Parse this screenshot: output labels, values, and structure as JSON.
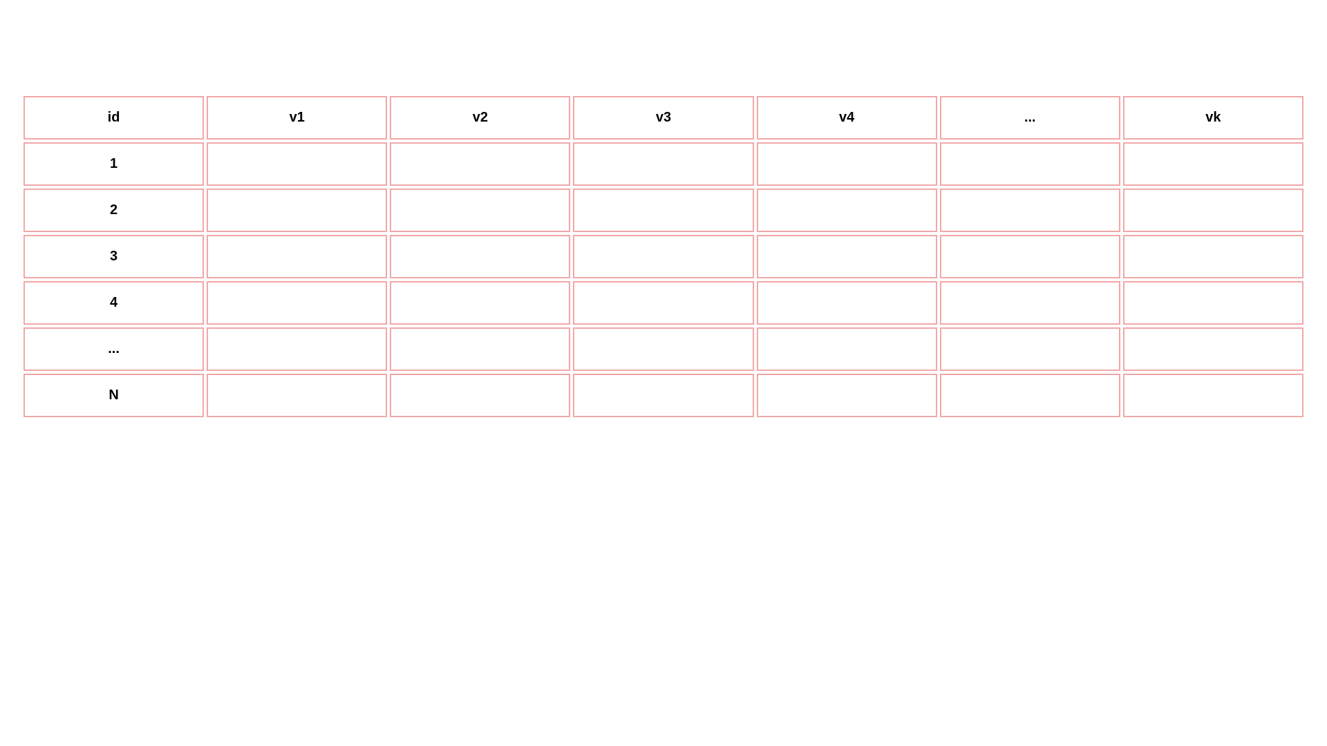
{
  "table": {
    "headers": [
      "id",
      "v1",
      "v2",
      "v3",
      "v4",
      "...",
      "vk"
    ],
    "rows": [
      {
        "label": "1",
        "cells": [
          "",
          "",
          "",
          "",
          "",
          ""
        ]
      },
      {
        "label": "2",
        "cells": [
          "",
          "",
          "",
          "",
          "",
          ""
        ]
      },
      {
        "label": "3",
        "cells": [
          "",
          "",
          "",
          "",
          "",
          ""
        ]
      },
      {
        "label": "4",
        "cells": [
          "",
          "",
          "",
          "",
          "",
          ""
        ]
      },
      {
        "label": "...",
        "cells": [
          "",
          "",
          "",
          "",
          "",
          ""
        ]
      },
      {
        "label": "N",
        "cells": [
          "",
          "",
          "",
          "",
          "",
          ""
        ]
      }
    ]
  }
}
